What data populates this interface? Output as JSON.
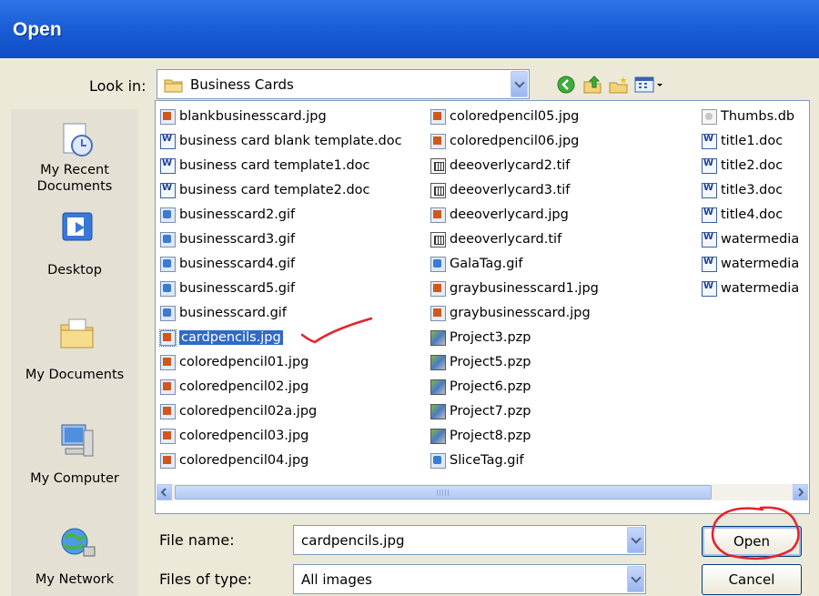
{
  "dialog": {
    "title": "Open"
  },
  "look_in": {
    "label": "Look in:",
    "value": "Business Cards",
    "icon": "folder-icon"
  },
  "toolbar": {
    "icons": [
      "back-icon",
      "up-folder-icon",
      "new-folder-icon",
      "view-menu-icon"
    ]
  },
  "places": [
    {
      "label": "My Recent Documents",
      "icon": "recent-documents-icon"
    },
    {
      "label": "Desktop",
      "icon": "desktop-icon"
    },
    {
      "label": "My Documents",
      "icon": "my-documents-icon"
    },
    {
      "label": "My Computer",
      "icon": "my-computer-icon"
    },
    {
      "label": "My Network",
      "icon": "my-network-icon"
    }
  ],
  "files": {
    "col1": [
      {
        "name": "blankbusinesscard.jpg",
        "type": "jpg"
      },
      {
        "name": "business card blank template.doc",
        "type": "doc"
      },
      {
        "name": "business card template1.doc",
        "type": "doc"
      },
      {
        "name": "business card template2.doc",
        "type": "doc"
      },
      {
        "name": "businesscard2.gif",
        "type": "gif"
      },
      {
        "name": "businesscard3.gif",
        "type": "gif"
      },
      {
        "name": "businesscard4.gif",
        "type": "gif"
      },
      {
        "name": "businesscard5.gif",
        "type": "gif"
      },
      {
        "name": "businesscard.gif",
        "type": "gif"
      },
      {
        "name": "cardpencils.jpg",
        "type": "jpg",
        "selected": true
      },
      {
        "name": "coloredpencil01.jpg",
        "type": "jpg"
      },
      {
        "name": "coloredpencil02.jpg",
        "type": "jpg"
      },
      {
        "name": "coloredpencil02a.jpg",
        "type": "jpg"
      },
      {
        "name": "coloredpencil03.jpg",
        "type": "jpg"
      },
      {
        "name": "coloredpencil04.jpg",
        "type": "jpg"
      }
    ],
    "col2": [
      {
        "name": "coloredpencil05.jpg",
        "type": "jpg"
      },
      {
        "name": "coloredpencil06.jpg",
        "type": "jpg"
      },
      {
        "name": "deeoverlycard2.tif",
        "type": "tif"
      },
      {
        "name": "deeoverlycard3.tif",
        "type": "tif"
      },
      {
        "name": "deeoverlycard.jpg",
        "type": "jpg"
      },
      {
        "name": "deeoverlycard.tif",
        "type": "tif"
      },
      {
        "name": "GalaTag.gif",
        "type": "gif"
      },
      {
        "name": "graybusinesscard1.jpg",
        "type": "jpg"
      },
      {
        "name": "graybusinesscard.jpg",
        "type": "jpg"
      },
      {
        "name": "Project3.pzp",
        "type": "pzp"
      },
      {
        "name": "Project5.pzp",
        "type": "pzp"
      },
      {
        "name": "Project6.pzp",
        "type": "pzp"
      },
      {
        "name": "Project7.pzp",
        "type": "pzp"
      },
      {
        "name": "Project8.pzp",
        "type": "pzp"
      },
      {
        "name": "SliceTag.gif",
        "type": "gif"
      }
    ],
    "col3": [
      {
        "name": "Thumbs.db",
        "type": "db"
      },
      {
        "name": "title1.doc",
        "type": "doc"
      },
      {
        "name": "title2.doc",
        "type": "doc"
      },
      {
        "name": "title3.doc",
        "type": "doc"
      },
      {
        "name": "title4.doc",
        "type": "doc"
      },
      {
        "name": "watermedia",
        "type": "doc"
      },
      {
        "name": "watermedia",
        "type": "doc"
      },
      {
        "name": "watermedia",
        "type": "doc"
      }
    ]
  },
  "file_name": {
    "label": "File name:",
    "value": "cardpencils.jpg"
  },
  "file_type": {
    "label": "Files of type:",
    "value": "All images"
  },
  "buttons": {
    "open": "Open",
    "cancel": "Cancel"
  },
  "colors": {
    "title_bar": "#1b5fd8",
    "selection": "#316ac5",
    "annotation": "#e8202a"
  }
}
